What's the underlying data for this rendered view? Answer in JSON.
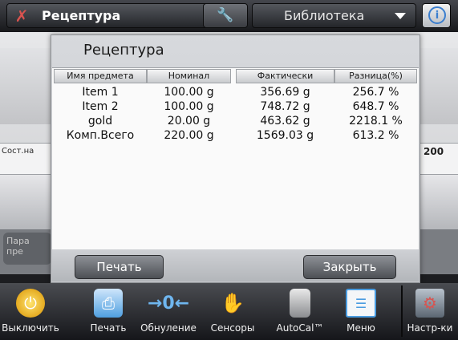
{
  "top_bar": {
    "mode_title": "Рецептура",
    "library_title": "Библиотека",
    "info_symbol": "i"
  },
  "background": {
    "side_label": "Сост.на",
    "side_value": "200",
    "side_button": "Пара пре"
  },
  "dialog": {
    "title": "Рецептура",
    "columns": [
      "Имя предмета",
      "Номинал",
      "Фактически",
      "Разница(%)"
    ],
    "rows": [
      [
        "Item 1",
        "100.00 g",
        "356.69 g",
        "256.7 %"
      ],
      [
        "Item 2",
        "100.00 g",
        "748.72 g",
        "648.7 %"
      ],
      [
        "gold",
        "20.00 g",
        "463.62 g",
        "2218.1 %"
      ],
      [
        "Комп.Всего",
        "220.00 g",
        "1569.03 g",
        "613.2 %"
      ]
    ],
    "print_label": "Печать",
    "close_label": "Закрыть"
  },
  "toolbar": {
    "items": [
      {
        "label": "Выключить",
        "icon": "power-icon",
        "color": "#f5b400"
      },
      {
        "label": "Печать",
        "icon": "printer-icon",
        "color": "#4f9fe0"
      },
      {
        "label": "Обнуление",
        "icon": "zero-icon",
        "color": "#5aa8e6"
      },
      {
        "label": "Сенсоры",
        "icon": "hand-sensor-icon",
        "color": "#f2b700"
      },
      {
        "label": "AutoCal™",
        "icon": "calibration-weight-icon",
        "color": "#c9c9c9"
      },
      {
        "label": "Меню",
        "icon": "menu-list-icon",
        "color": "#4a9ce0"
      },
      {
        "label": "Настр-ки",
        "icon": "settings-icon",
        "color": "#d9534f"
      }
    ]
  }
}
